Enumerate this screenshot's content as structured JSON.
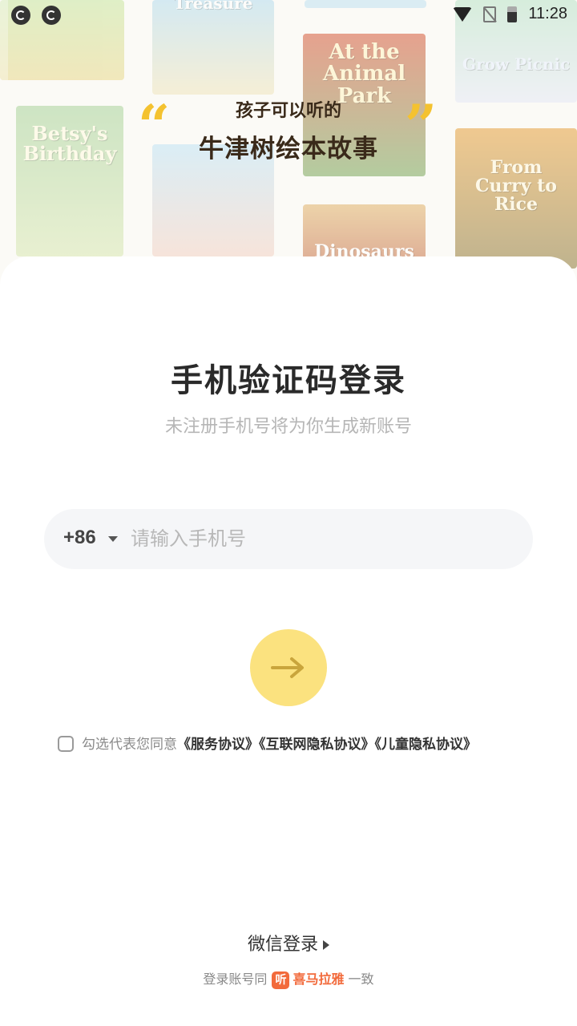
{
  "status_bar": {
    "time": "11:28",
    "left_icons": [
      "app-notification-icon",
      "app-notification-icon"
    ],
    "right_icons": [
      "wifi-icon",
      "no-sim-icon",
      "battery-icon"
    ]
  },
  "background": {
    "books": [
      {
        "title": "Treasure"
      },
      {
        "title": "At the Animal Park"
      },
      {
        "title": "Grow Picnic"
      },
      {
        "title": "Betsy's Birthday"
      },
      {
        "title": "From Curry to Rice"
      },
      {
        "title": "Dinosaurs"
      }
    ]
  },
  "hero": {
    "subtitle": "孩子可以听的",
    "title": "牛津树绘本故事",
    "accent_color": "#f4c230"
  },
  "login": {
    "title": "手机验证码登录",
    "subtitle": "未注册手机号将为你生成新账号",
    "country_code": "+86",
    "phone_placeholder": "请输入手机号",
    "next_button_color": "#fbe27f"
  },
  "agreement": {
    "prefix": "勾选代表您同意",
    "links": [
      "《服务协议》",
      "《互联网隐私协议》",
      "《儿童隐私协议》"
    ],
    "checked": false
  },
  "alt_login": {
    "wechat_label": "微信登录"
  },
  "account_sync": {
    "prefix": "登录账号同",
    "logo_glyph": "听",
    "brand": "喜马拉雅",
    "suffix": "一致",
    "brand_color": "#f26a3b"
  }
}
